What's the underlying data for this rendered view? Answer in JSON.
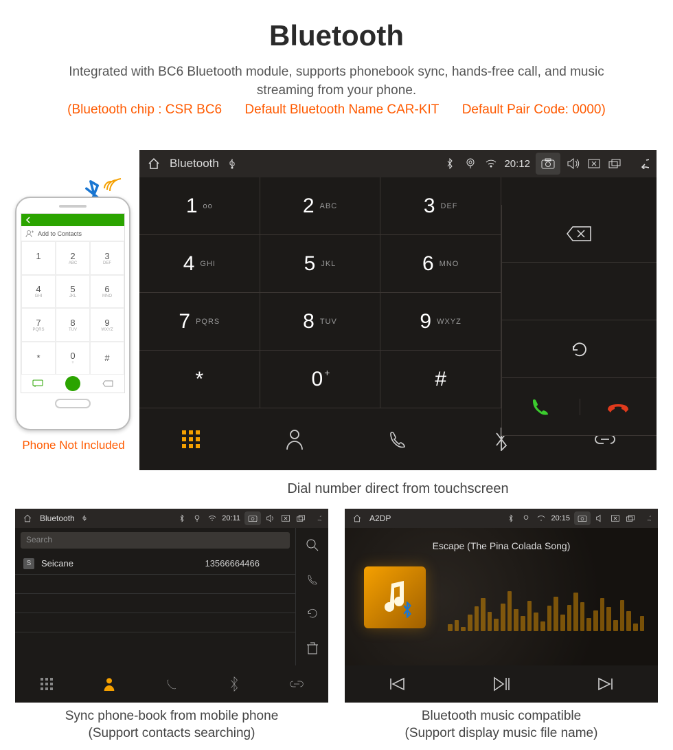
{
  "page": {
    "title": "Bluetooth",
    "subtitle": "Integrated with BC6 Bluetooth module, supports phonebook sync, hands-free call, and music streaming from your phone.",
    "note_chip": "(Bluetooth chip : CSR BC6",
    "note_name": "Default Bluetooth Name CAR-KIT",
    "note_code": "Default Pair Code: 0000)"
  },
  "phone": {
    "add_contacts": "Add to Contacts",
    "not_included": "Phone Not Included"
  },
  "dialer": {
    "status": {
      "title": "Bluetooth",
      "time": "20:12"
    },
    "keys": {
      "k1": {
        "d": "1",
        "s": "oo"
      },
      "k2": {
        "d": "2",
        "s": "ABC"
      },
      "k3": {
        "d": "3",
        "s": "DEF"
      },
      "k4": {
        "d": "4",
        "s": "GHI"
      },
      "k5": {
        "d": "5",
        "s": "JKL"
      },
      "k6": {
        "d": "6",
        "s": "MNO"
      },
      "k7": {
        "d": "7",
        "s": "PQRS"
      },
      "k8": {
        "d": "8",
        "s": "TUV"
      },
      "k9": {
        "d": "9",
        "s": "WXYZ"
      },
      "kstar": {
        "d": "*",
        "s": ""
      },
      "k0": {
        "d": "0",
        "s": "+"
      },
      "khash": {
        "d": "#",
        "s": ""
      }
    },
    "caption": "Dial number direct from touchscreen"
  },
  "contacts": {
    "status": {
      "title": "Bluetooth",
      "time": "20:11"
    },
    "search_placeholder": "Search",
    "row": {
      "badge": "S",
      "name": "Seicane",
      "number": "13566664466"
    },
    "caption_line1": "Sync phone-book from mobile phone",
    "caption_line2": "(Support contacts searching)"
  },
  "music": {
    "status": {
      "title": "A2DP",
      "time": "20:15"
    },
    "song": "Escape (The Pina Colada Song)",
    "caption_line1": "Bluetooth music compatible",
    "caption_line2": "(Support display music file name)"
  }
}
